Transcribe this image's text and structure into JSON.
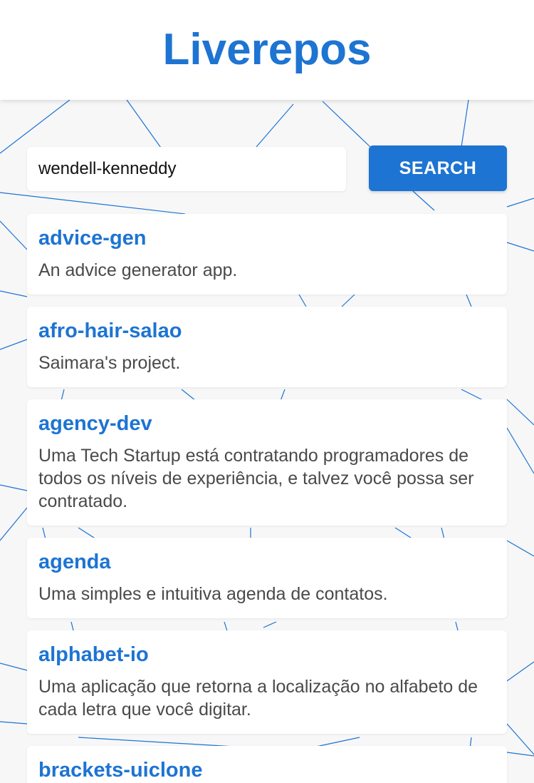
{
  "app": {
    "title": "Liverepos",
    "accent_color": "#1d74d2"
  },
  "search": {
    "value": "wendell-kenneddy",
    "button_label": "SEARCH"
  },
  "repos": [
    {
      "name": "advice-gen",
      "description": "An advice generator app."
    },
    {
      "name": "afro-hair-salao",
      "description": "Saimara's project."
    },
    {
      "name": "agency-dev",
      "description": "Uma Tech Startup está contratando programadores de todos os níveis de experiência, e talvez você possa ser contratado."
    },
    {
      "name": "agenda",
      "description": "Uma simples e intuitiva agenda de contatos."
    },
    {
      "name": "alphabet-io",
      "description": "Uma aplicação que retorna a localização no alfabeto de cada letra que você digitar."
    },
    {
      "name": "brackets-uiclone",
      "description": ""
    }
  ]
}
